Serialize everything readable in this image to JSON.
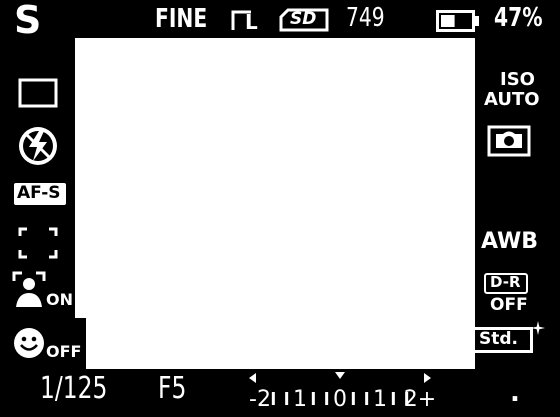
{
  "top_bar": {
    "mode": "S",
    "quality": "FINE",
    "image_size": "L",
    "card": "SD",
    "shots_remaining": "749",
    "battery_percent": "47%",
    "battery_level": 0.47
  },
  "left_panel": {
    "drive_mode_icon": "single-shot-icon",
    "flash_icon": "flash-off-icon",
    "focus_mode": "AF-S",
    "focus_area_icon": "wide-focus-area-icon",
    "face_detection_state": "ON",
    "smile_shutter_state": "OFF"
  },
  "right_panel": {
    "iso_label": "ISO",
    "iso_value": "AUTO",
    "metering_icon": "multi-segment-metering-icon",
    "white_balance": "AWB",
    "dro_label": "D-R",
    "dro_value": "OFF",
    "creative_style": "Std."
  },
  "bottom_bar": {
    "shutter_speed": "1/125",
    "aperture": "F5",
    "exposure_scale": {
      "labels": [
        "-2",
        "1",
        "0",
        "1",
        "2+"
      ],
      "current_value": 0
    },
    "indicator": "."
  },
  "colors": {
    "background": "#000000",
    "foreground": "#ffffff"
  }
}
